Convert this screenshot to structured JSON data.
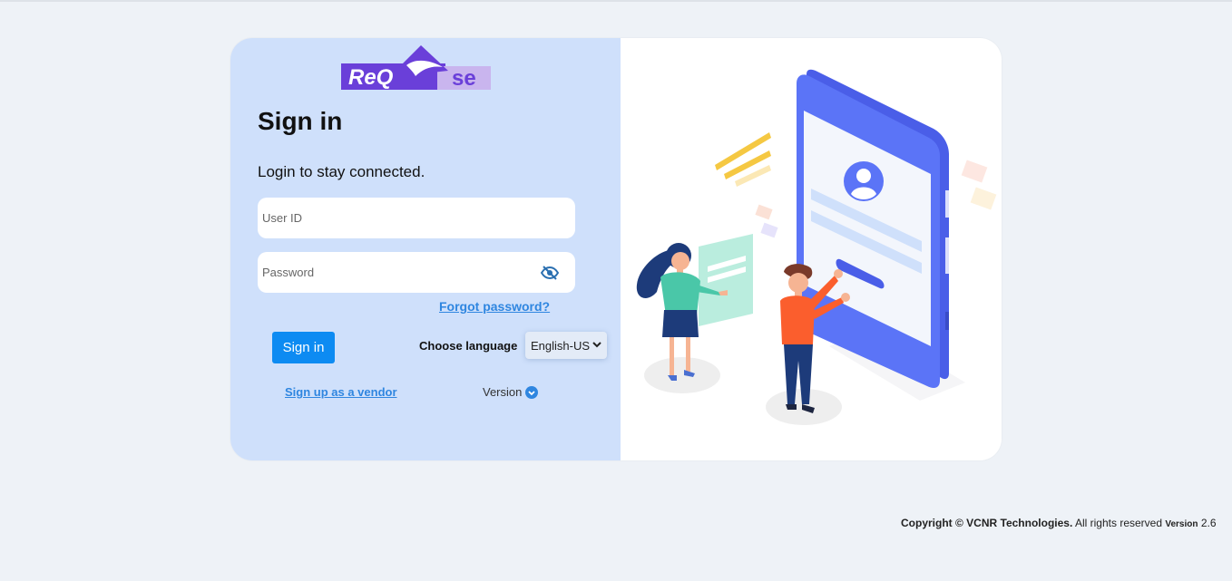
{
  "brand": {
    "logo_text_left": "ReQ",
    "logo_text_right": "se",
    "accent": "#6a3fd9"
  },
  "login": {
    "title": "Sign in",
    "subtitle": "Login to stay connected.",
    "user_placeholder": "User ID",
    "password_placeholder": "Password",
    "forgot_label": "Forgot password?",
    "signin_label": "Sign in",
    "language_label": "Choose language",
    "language_value": "English-US",
    "vendor_label": "Sign up as a vendor",
    "version_label": "Version"
  },
  "footer": {
    "copyright": "Copyright © VCNR Technologies.",
    "rights": " All rights reserved ",
    "version_label": "Version",
    "version_value": " 2.6"
  },
  "colors": {
    "page_bg": "#eef2f7",
    "panel_bg": "#cfe0fb",
    "link": "#2f86e0",
    "button": "#0d8bf2"
  }
}
